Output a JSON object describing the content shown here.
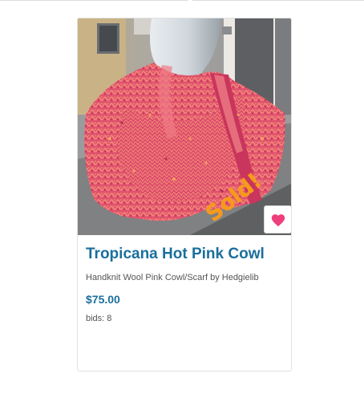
{
  "product": {
    "title": "Tropicana Hot Pink Cowl",
    "subtitle": "Handknit Wool Pink Cowl/Scarf by Hedgielib",
    "price": "$75.00",
    "bids_label": "bids:",
    "bids_count": "8",
    "sold_badge": "Sold!",
    "favorite_icon": "heart-icon"
  },
  "colors": {
    "brand_blue": "#1a6f9c",
    "heart_pink": "#ee3f7d",
    "sold_orange": "#f59a1d"
  }
}
